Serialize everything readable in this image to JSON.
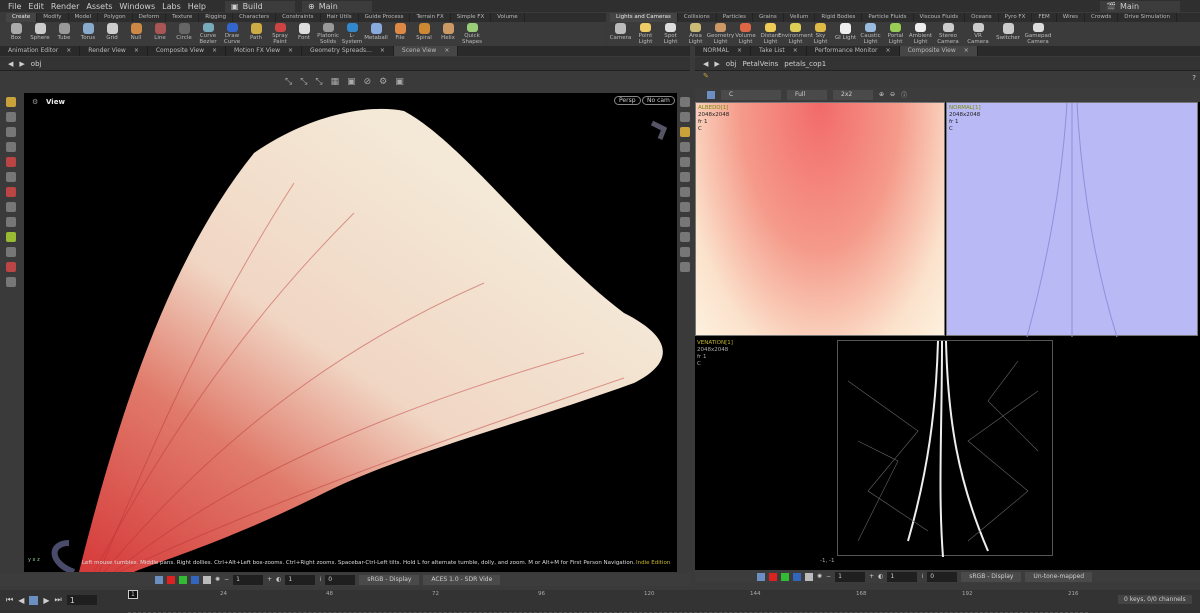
{
  "menu": [
    "File",
    "Edit",
    "Render",
    "Assets",
    "Windows",
    "Labs",
    "Help"
  ],
  "desktop": "Build",
  "context": "Main",
  "right_context": "Main",
  "shelf_tabs_left": [
    "Create",
    "Modify",
    "Model",
    "Polygon",
    "Deform",
    "Texture",
    "Rigging",
    "Characters",
    "Constraints",
    "Hair Utils",
    "Guide Process",
    "Terrain FX",
    "Simple FX",
    "Volume"
  ],
  "shelf_tools_left": [
    "Box",
    "Sphere",
    "Tube",
    "Torus",
    "Grid",
    "Null",
    "Line",
    "Circle",
    "Curve Bezier",
    "Draw Curve",
    "Path",
    "Spray Paint",
    "Font",
    "Platonic Solids",
    "L-System",
    "Metaball",
    "File",
    "Spiral",
    "Helix",
    "Quick Shapes"
  ],
  "shelf_tabs_right": [
    "Lights and Cameras",
    "Collisions",
    "Particles",
    "Grains",
    "Vellum",
    "Rigid Bodies",
    "Particle Fluids",
    "Viscous Fluids",
    "Oceans",
    "Pyro FX",
    "FEM",
    "Wires",
    "Crowds",
    "Drive Simulation"
  ],
  "shelf_tools_right": [
    "Camera",
    "Point Light",
    "Spot Light",
    "Area Light",
    "Geometry Light",
    "Volume Light",
    "Distant Light",
    "Environment Light",
    "Sky Light",
    "GI Light",
    "Caustic Light",
    "Portal Light",
    "Ambient Light",
    "Stereo Camera",
    "VR Camera",
    "Switcher",
    "Gamepad Camera"
  ],
  "pane_tabs_left": [
    "Animation Editor",
    "Render View",
    "Composite View",
    "Motion FX View",
    "Geometry Spreads...",
    "Scene View"
  ],
  "pane_tabs_right": [
    "NORMAL",
    "Take List",
    "Performance Monitor",
    "Composite View"
  ],
  "left_path": [
    "obj"
  ],
  "right_path": [
    "obj",
    "PetalVeins",
    "petals_cop1"
  ],
  "viewport": {
    "title": "View",
    "persp": "Persp",
    "cam": "No cam",
    "hint": "Left mouse tumbles. Middle pans. Right dollies. Ctrl+Alt+Left box-zooms. Ctrl+Right zooms. Spacebar-Ctrl-Left tilts. Hold L for alternate tumble, dolly, and zoom. M or Alt+M for First Person Navigation.",
    "edition": "Indie Edition",
    "axes": "y x z"
  },
  "comp_toolbar": {
    "channel": "C",
    "res": "Full",
    "layout": "2x2"
  },
  "images": [
    {
      "name": "ALBEDO[1]",
      "size": "2048x2048",
      "frame": "fr 1",
      "chan": "C"
    },
    {
      "name": "NORMAL[1]",
      "size": "2048x2048",
      "frame": "fr 1",
      "chan": "C"
    },
    {
      "name": "VENATION[1]",
      "size": "2048x2048",
      "frame": "fr 1",
      "chan": "C"
    }
  ],
  "coords": "-1, -1",
  "left_bottom": {
    "v1": "1",
    "v2": "1",
    "v3": "0",
    "display": "sRGB - Display",
    "view": "ACES 1.0 - SDR Vide"
  },
  "right_bottom": {
    "v1": "1",
    "v2": "1",
    "v3": "0",
    "display": "sRGB - Display",
    "view": "Un-tone-mapped"
  },
  "timeline": {
    "frame": "1",
    "current": "1",
    "ticks": [
      "24",
      "48",
      "72",
      "96",
      "120",
      "144",
      "168",
      "192",
      "216"
    ],
    "keys": "0 keys, 0/0 channels"
  }
}
